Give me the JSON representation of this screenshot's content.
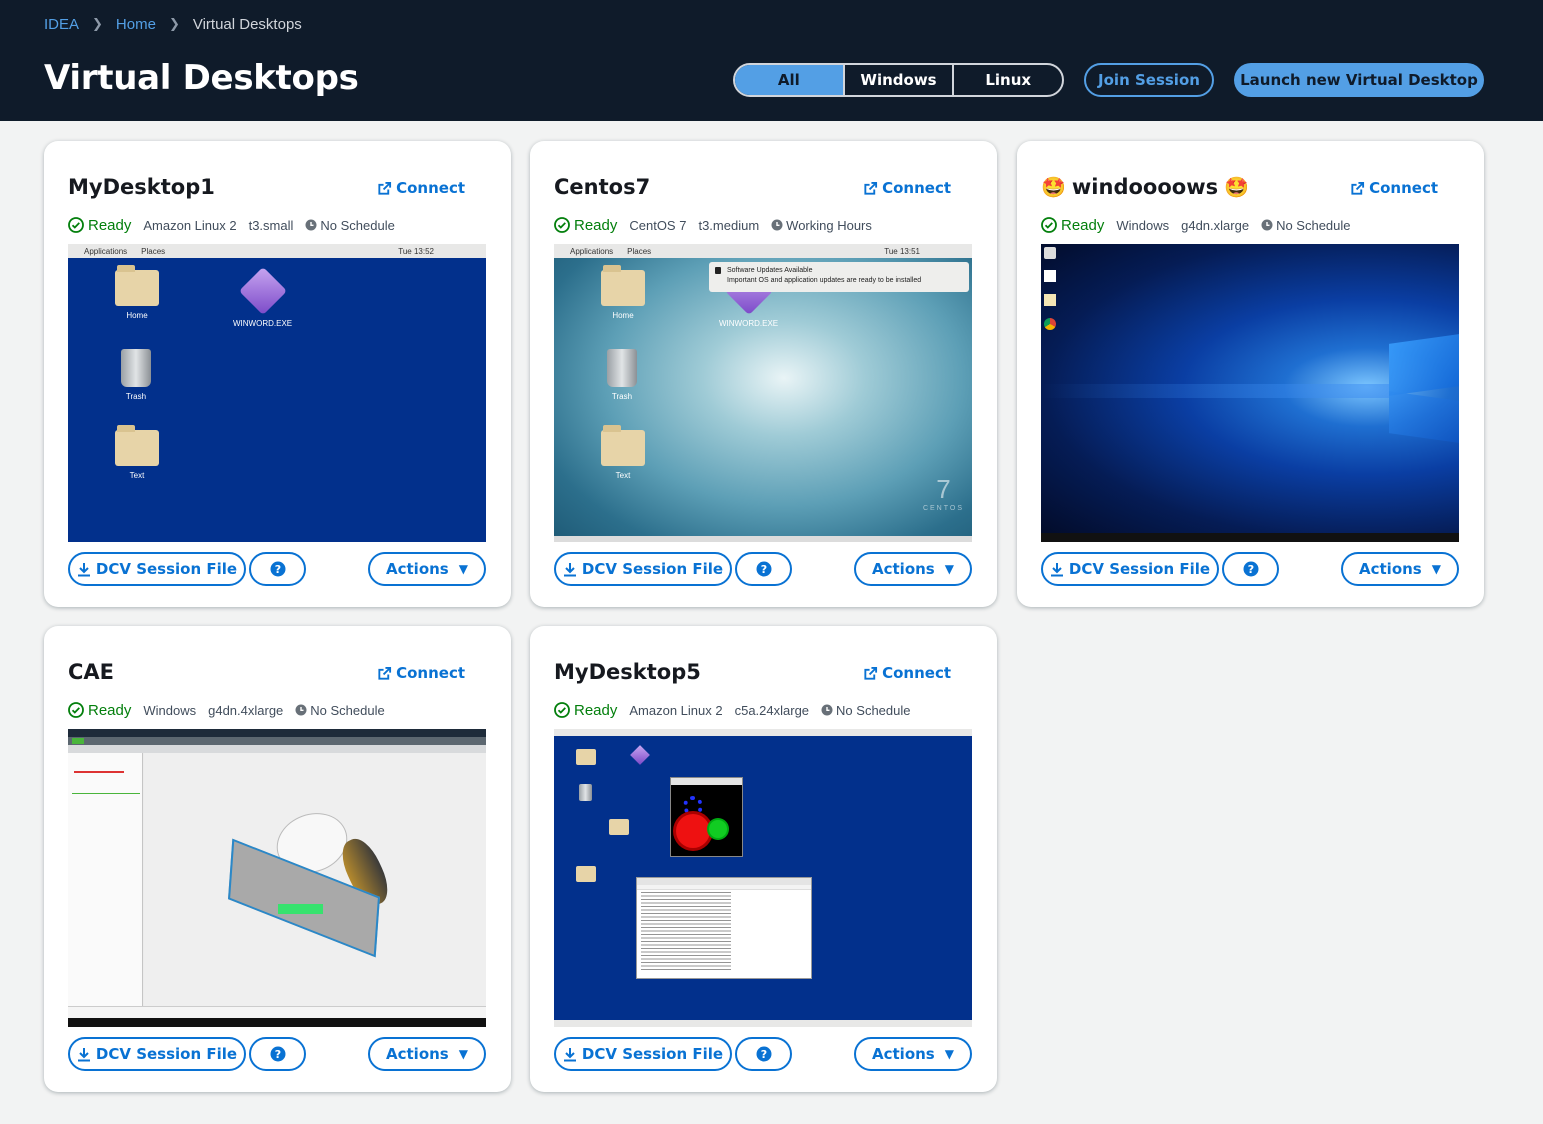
{
  "breadcrumb": [
    "IDEA",
    "Home",
    "Virtual Desktops"
  ],
  "page_title": "Virtual Desktops",
  "filter": {
    "options": [
      "All",
      "Windows",
      "Linux"
    ],
    "selected": "All"
  },
  "join_label": "Join Session",
  "launch_label": "Launch new Virtual Desktop",
  "labels": {
    "connect": "Connect",
    "dcv": "DCV Session File",
    "help": "?",
    "actions": "Actions",
    "ready": "Ready"
  },
  "sessions": [
    {
      "name": "MyDesktop1",
      "os": "Amazon Linux 2",
      "instance": "t3.small",
      "schedule": "No Schedule"
    },
    {
      "name": "Centos7",
      "os": "CentOS 7",
      "instance": "t3.medium",
      "schedule": "Working Hours"
    },
    {
      "name": "windoooows",
      "os": "Windows",
      "instance": "g4dn.xlarge",
      "schedule": "No Schedule"
    },
    {
      "name": "CAE",
      "os": "Windows",
      "instance": "g4dn.4xlarge",
      "schedule": "No Schedule"
    },
    {
      "name": "MyDesktop5",
      "os": "Amazon Linux 2",
      "instance": "c5a.24xlarge",
      "schedule": "No Schedule"
    }
  ],
  "screens": {
    "linux_topbar": [
      "Applications",
      "Places"
    ],
    "time1": "Tue 13:52",
    "time2": "Tue 13:51",
    "desktop_icons": [
      "Home",
      "WINWORD.EXE",
      "Trash",
      "Text"
    ],
    "notification_title": "Software Updates Available",
    "notification_body": "Important OS and application updates are ready to be installed",
    "centos_brand": "CENTOS",
    "centos_version": "7"
  },
  "colors": {
    "header_bg": "#0f1b2a",
    "accent": "#539fe5",
    "link": "#0972d3",
    "ready": "#037f0c"
  }
}
